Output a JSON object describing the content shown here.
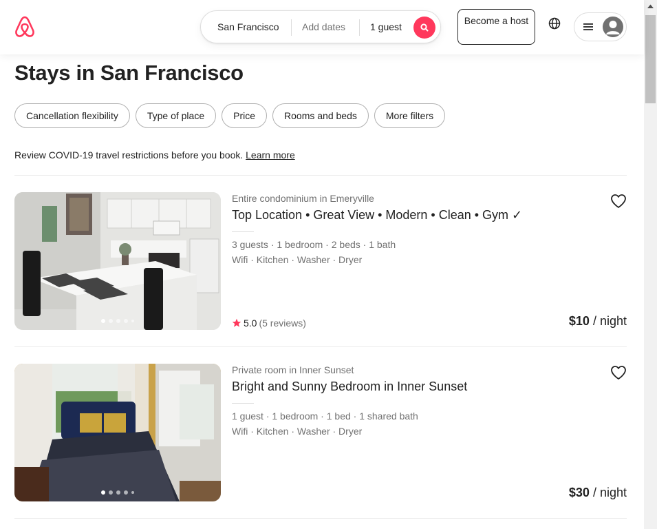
{
  "header": {
    "search": {
      "location": "San Francisco",
      "dates": "Add dates",
      "guests": "1 guest"
    },
    "host_button": "Become a host"
  },
  "page": {
    "title": "Stays in San Francisco",
    "filters": [
      "Cancellation flexibility",
      "Type of place",
      "Price",
      "Rooms and beds",
      "More filters"
    ],
    "covid_notice": "Review COVID-19 travel restrictions before you book.",
    "covid_link": "Learn more"
  },
  "listings": [
    {
      "type": "Entire condominium in Emeryville",
      "title": "Top Location • Great View • Modern • Clean • Gym ✓",
      "details": "3 guests · 1 bedroom · 2 beds · 1 bath",
      "amenities": "Wifi · Kitchen · Washer · Dryer",
      "rating": "5.0",
      "reviews": "(5 reviews)",
      "price": "$10",
      "price_unit": " / night"
    },
    {
      "type": "Private room in Inner Sunset",
      "title": "Bright and Sunny Bedroom in Inner Sunset",
      "details": "1 guest · 1 bedroom · 1 bed · 1 shared bath",
      "amenities": "Wifi · Kitchen · Washer · Dryer",
      "price": "$30",
      "price_unit": " / night"
    }
  ],
  "colors": {
    "brand": "#ff385c",
    "text": "#222222",
    "muted": "#717171"
  }
}
